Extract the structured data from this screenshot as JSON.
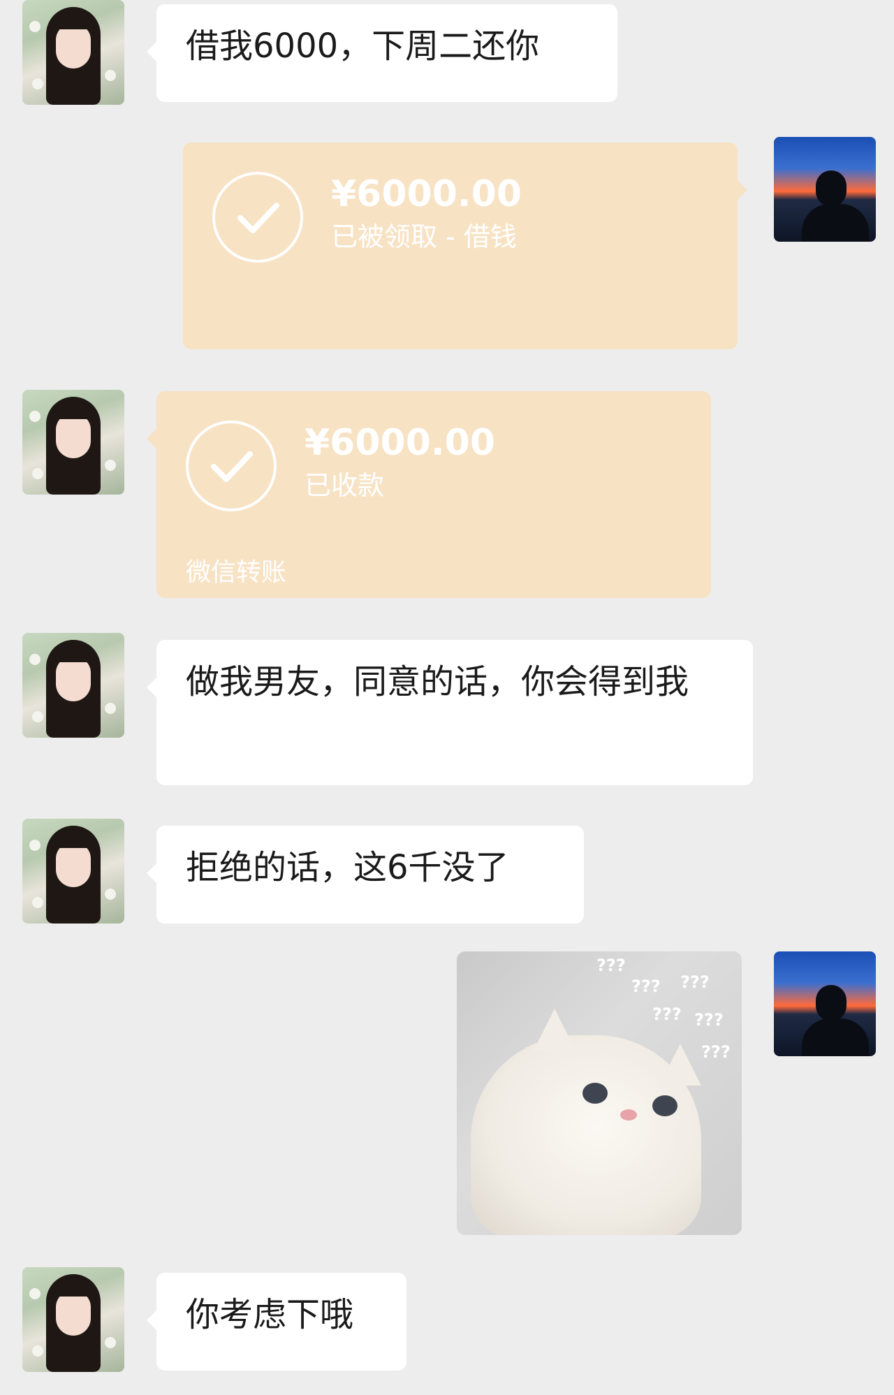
{
  "messages": {
    "m1": "借我6000，下周二还你",
    "m4": "做我男友，同意的话，你会得到我",
    "m5": "拒绝的话，这6千没了",
    "m7": "你考虑下哦"
  },
  "transfer_sent": {
    "amount": "¥6000.00",
    "status": "已被领取 - 借钱"
  },
  "transfer_received": {
    "amount": "¥6000.00",
    "status": "已收款",
    "footer": "微信转账"
  },
  "sticker": {
    "marks": [
      "???",
      "???",
      "???",
      "???",
      "???",
      "???"
    ]
  },
  "colors": {
    "background": "#ededed",
    "bubble": "#ffffff",
    "transfer": "#f7e2c4"
  },
  "icons": [
    "check-circle-icon"
  ]
}
